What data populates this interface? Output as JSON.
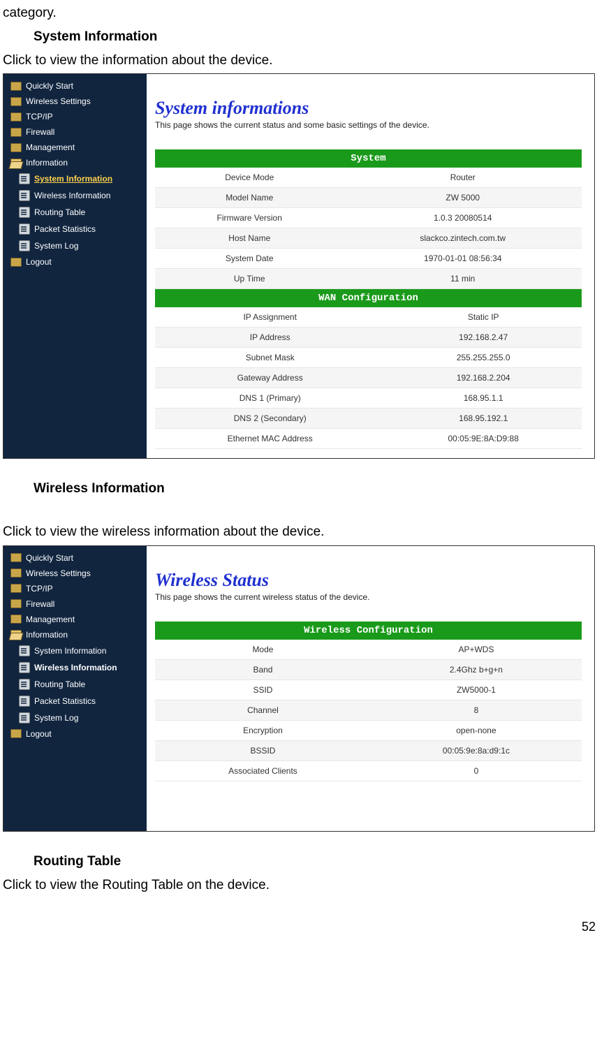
{
  "pre_text": "category.",
  "sections": {
    "sysinfo_heading": "System Information",
    "sysinfo_body": "Click to view the information about the device.",
    "wireless_heading": "Wireless Information",
    "wireless_body": "Click to view the wireless information about the device.",
    "routing_heading": "Routing Table",
    "routing_body": "Click to view the Routing Table on the device."
  },
  "nav": {
    "items": [
      {
        "label": "Quickly Start"
      },
      {
        "label": "Wireless Settings"
      },
      {
        "label": "TCP/IP"
      },
      {
        "label": "Firewall"
      },
      {
        "label": "Management"
      },
      {
        "label": "Information"
      }
    ],
    "subitems": [
      {
        "label": "System Information"
      },
      {
        "label": "Wireless Information"
      },
      {
        "label": "Routing Table"
      },
      {
        "label": "Packet Statistics"
      },
      {
        "label": "System Log"
      }
    ],
    "logout": "Logout"
  },
  "panel1": {
    "title": "System informations",
    "desc": "This page shows the current status and some basic settings of the device.",
    "band1": "System",
    "system_rows": [
      {
        "k": "Device Mode",
        "v": "Router"
      },
      {
        "k": "Model Name",
        "v": "ZW 5000"
      },
      {
        "k": "Firmware Version",
        "v": "1.0.3 20080514"
      },
      {
        "k": "Host Name",
        "v": "slackco.zintech.com.tw"
      },
      {
        "k": "System Date",
        "v": "1970-01-01 08:56:34"
      },
      {
        "k": "Up Time",
        "v": "11 min"
      }
    ],
    "band2": "WAN Configuration",
    "wan_rows": [
      {
        "k": "IP Assignment",
        "v": "Static IP"
      },
      {
        "k": "IP Address",
        "v": "192.168.2.47"
      },
      {
        "k": "Subnet Mask",
        "v": "255.255.255.0"
      },
      {
        "k": "Gateway Address",
        "v": "192.168.2.204"
      },
      {
        "k": "DNS 1 (Primary)",
        "v": "168.95.1.1"
      },
      {
        "k": "DNS 2 (Secondary)",
        "v": "168.95.192.1"
      },
      {
        "k": "Ethernet MAC Address",
        "v": "00:05:9E:8A:D9:88"
      }
    ]
  },
  "panel2": {
    "title": "Wireless Status",
    "desc": "This page shows the current wireless status of the device.",
    "band": "Wireless Configuration",
    "rows": [
      {
        "k": "Mode",
        "v": "AP+WDS"
      },
      {
        "k": "Band",
        "v": "2.4Ghz b+g+n"
      },
      {
        "k": "SSID",
        "v": "ZW5000-1"
      },
      {
        "k": "Channel",
        "v": "8"
      },
      {
        "k": "Encryption",
        "v": "open-none"
      },
      {
        "k": "BSSID",
        "v": "00:05:9e:8a:d9:1c"
      },
      {
        "k": "Associated Clients",
        "v": "0"
      }
    ]
  },
  "page_num": "52"
}
